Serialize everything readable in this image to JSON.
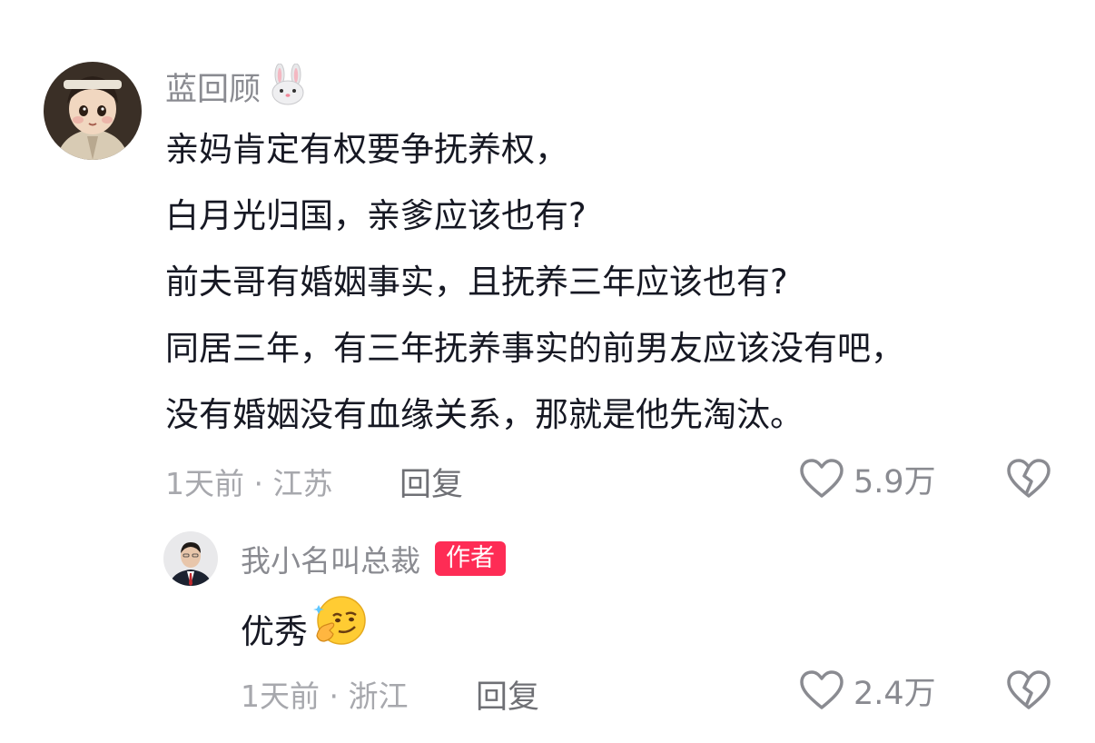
{
  "comments": [
    {
      "author": "蓝回顾",
      "lines": [
        "亲妈肯定有权要争抚养权，",
        "白月光归国，亲爹应该也有?",
        "前夫哥有婚姻事实，且抚养三年应该也有?",
        "同居三年，有三年抚养事实的前男友应该没有吧，",
        "没有婚姻没有血缘关系，那就是他先淘汰。"
      ],
      "time_location": "1天前 · 江苏",
      "reply_label": "回复",
      "likes": "5.9万"
    }
  ],
  "reply": {
    "author": "我小名叫总裁",
    "badge": "作者",
    "text": "优秀",
    "time_location": "1天前 · 浙江",
    "reply_label": "回复",
    "likes": "2.4万"
  },
  "icons": {
    "author_emoji": "rabbit-face-icon",
    "reply_emoji": "smirking-face-icon",
    "like": "heart-outline-icon",
    "dislike": "broken-heart-icon"
  },
  "colors": {
    "text": "#161823",
    "secondary": "#8a8b91",
    "author_badge": "#fe2c55"
  }
}
